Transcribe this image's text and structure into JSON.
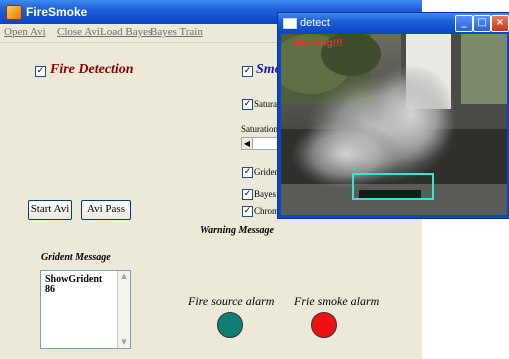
{
  "main_window": {
    "title": "FireSmoke",
    "menu": [
      "Open Avi",
      "Close Avi",
      "Load Bayes",
      "Bayes Train"
    ],
    "fire_detection": {
      "label": "Fire Detection",
      "checked": true
    },
    "smoke_detection": {
      "label": "Smo",
      "checked": true
    },
    "options": [
      {
        "label": "Saturati",
        "checked": true
      },
      {
        "label": "Griden",
        "checked": true
      },
      {
        "label": "Bayes",
        "checked": true
      },
      {
        "label": "Chrom",
        "checked": true
      }
    ],
    "saturation_label": "Saturation",
    "buttons": {
      "start_avi": "Start Avi",
      "avi_pass": "Avi Pass"
    },
    "warning_message_label": "Warning Message",
    "grident_message_label": "Grident Message",
    "grident_text": [
      "ShowGrident",
      "86"
    ],
    "fire_alarm": {
      "label": "Fire source alarm",
      "color": "#0e7f72"
    },
    "smoke_alarm": {
      "label": "Frie smoke alarm",
      "color": "#ee1111"
    }
  },
  "detect_window": {
    "title": "detect",
    "warning_text": "Warning!!!",
    "box_color": "#40e0d0"
  }
}
